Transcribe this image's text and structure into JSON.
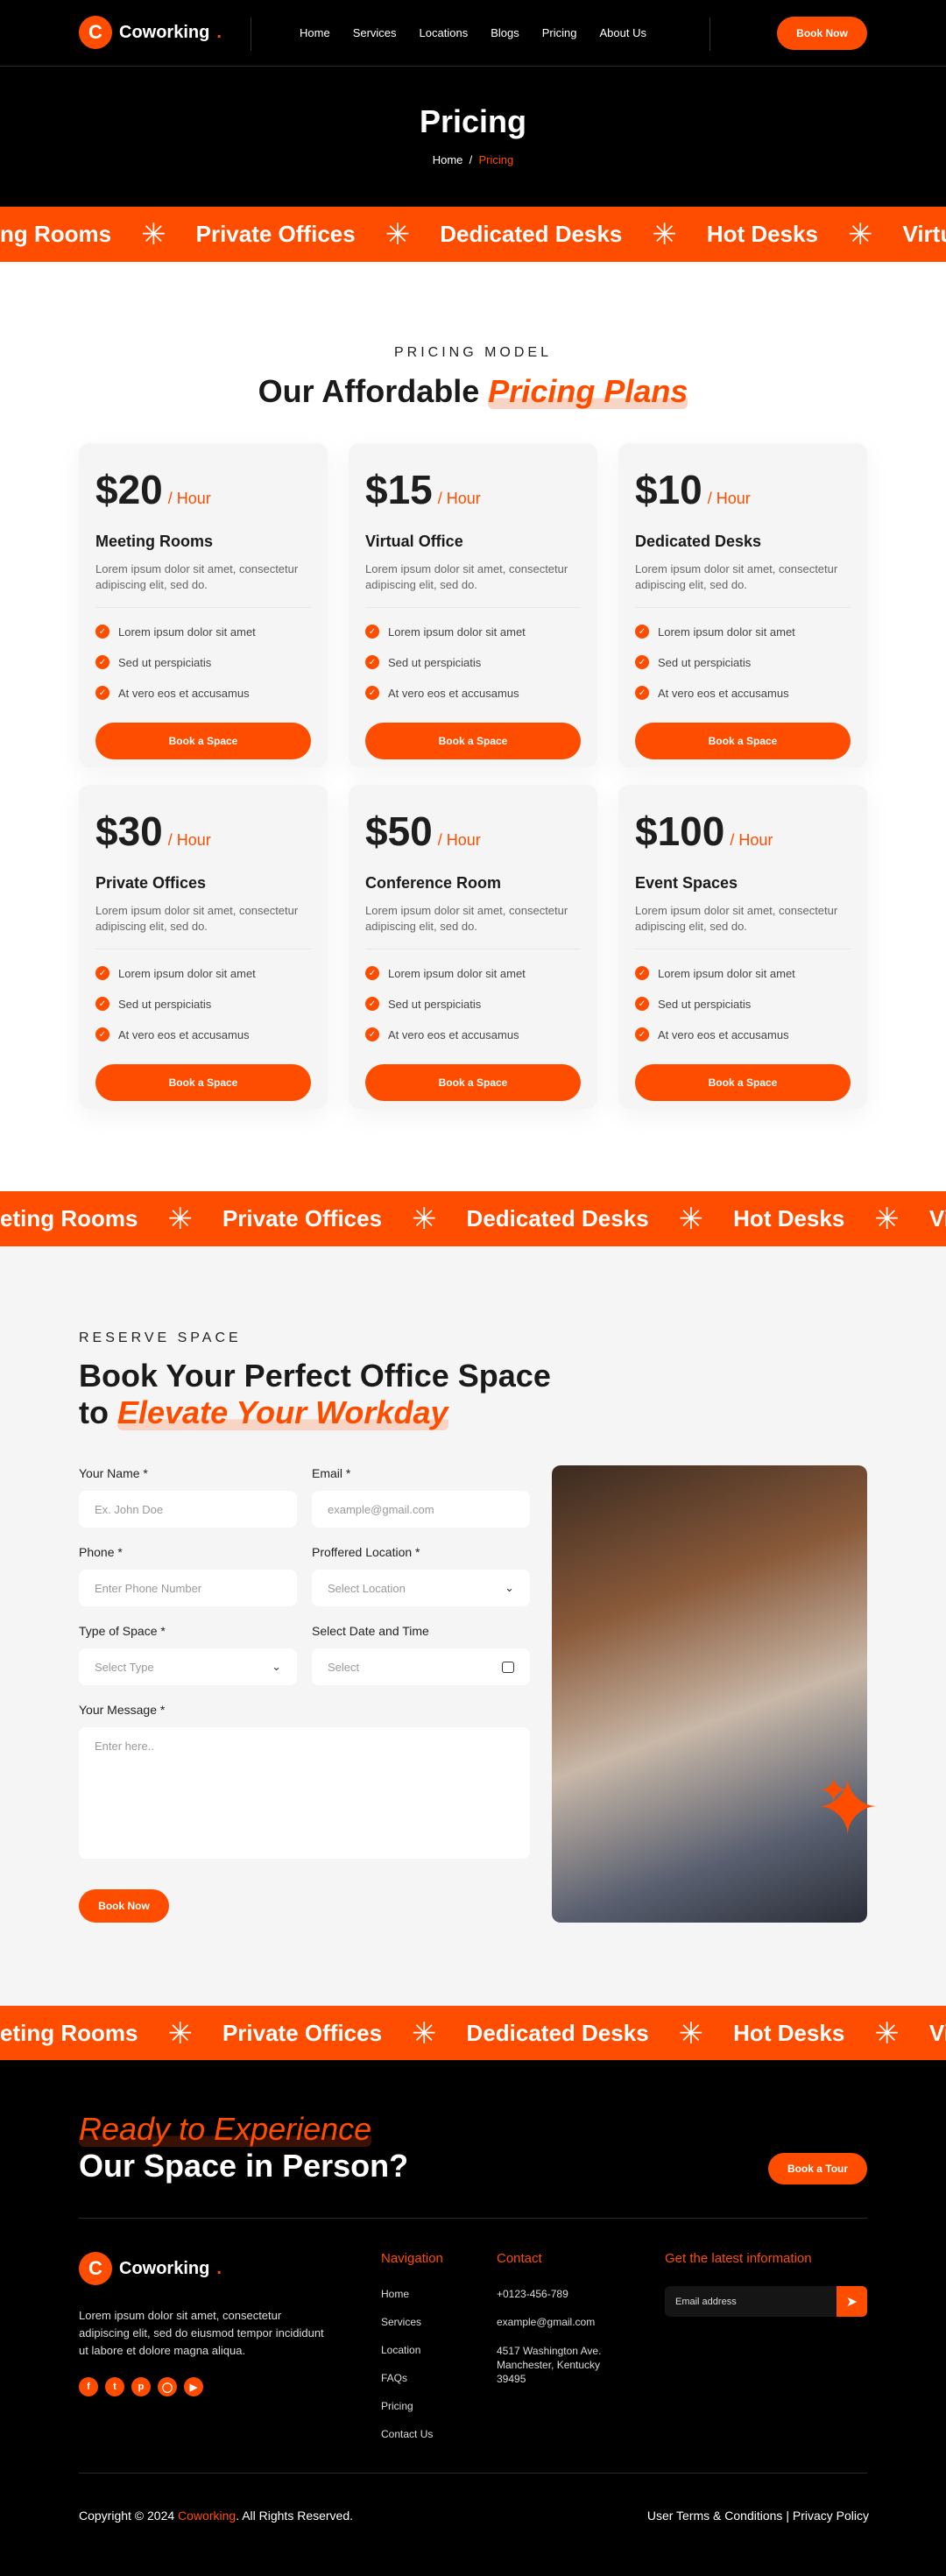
{
  "brand": {
    "name": "Coworking",
    "dot": ".",
    "accent": "#FF4D00"
  },
  "nav": [
    "Home",
    "Services",
    "Locations",
    "Blogs",
    "Pricing",
    "About Us"
  ],
  "header_cta": "Book Now",
  "hero": {
    "title": "Pricing",
    "crumb_home": "Home",
    "crumb_sep": "/",
    "crumb_current": "Pricing"
  },
  "marquee1": [
    "ng Rooms",
    "Private Offices",
    "Dedicated Desks",
    "Hot Desks",
    "Virtual O"
  ],
  "marquee2": [
    "eting Rooms",
    "Private Offices",
    "Dedicated Desks",
    "Hot Desks",
    "Virtua"
  ],
  "marquee3": [
    "eting Rooms",
    "Private Offices",
    "Dedicated Desks",
    "Hot Desks",
    "Virtua"
  ],
  "pricing": {
    "eyebrow": "PRICING MODEL",
    "title": "Our Affordable",
    "title_hl": "Pricing Plans",
    "unit": "/ Hour",
    "desc": "Lorem ipsum dolor sit amet, consectetur adipiscing elit, sed do.",
    "features": [
      "Lorem ipsum dolor sit amet",
      "Sed ut perspiciatis",
      "At vero eos et accusamus"
    ],
    "button": "Book a Space",
    "plans": [
      {
        "price": "$20",
        "name": "Meeting Rooms"
      },
      {
        "price": "$15",
        "name": "Virtual Office"
      },
      {
        "price": "$10",
        "name": "Dedicated Desks"
      },
      {
        "price": "$30",
        "name": "Private Offices"
      },
      {
        "price": "$50",
        "name": "Conference Room"
      },
      {
        "price": "$100",
        "name": "Event Spaces"
      }
    ]
  },
  "reserve": {
    "eyebrow": "RESERVE SPACE",
    "title1": "Book Your Perfect Office Space",
    "title2": "to",
    "title_hl": "Elevate Your Workday",
    "name_label": "Your Name *",
    "name_ph": "Ex. John Doe",
    "email_label": "Email *",
    "email_ph": "example@gmail.com",
    "phone_label": "Phone *",
    "phone_ph": "Enter Phone Number",
    "loc_label": "Proffered Location *",
    "loc_ph": "Select Location",
    "type_label": "Type of Space *",
    "type_ph": "Select Type",
    "date_label": "Select Date and Time",
    "date_ph": "Select",
    "msg_label": "Your Message *",
    "msg_ph": "Enter here..",
    "submit": "Book Now"
  },
  "cta": {
    "line1": "Ready to Experience",
    "line2": "Our Space in Person?",
    "button": "Book a Tour"
  },
  "footer": {
    "about": "Lorem ipsum dolor sit amet, consectetur adipiscing elit, sed do eiusmod tempor incididunt ut labore et dolore magna aliqua.",
    "socials": [
      "facebook-icon",
      "twitter-icon",
      "pinterest-icon",
      "instagram-icon",
      "youtube-icon"
    ],
    "nav_title": "Navigation",
    "nav": [
      "Home",
      "Services",
      "Location",
      "FAQs",
      "Pricing",
      "Contact Us"
    ],
    "contact_title": "Contact",
    "phone": "+0123-456-789",
    "email": "example@gmail.com",
    "address": "4517 Washington Ave. Manchester, Kentucky 39495",
    "news_title": "Get the latest information",
    "news_ph": "Email address",
    "copy_pre": "Copyright © 2024 ",
    "copy_brand": "Coworking",
    "copy_post": ". All Rights Reserved.",
    "terms": "User Terms & Conditions",
    "sep": "|",
    "privacy": "Privacy Policy"
  }
}
